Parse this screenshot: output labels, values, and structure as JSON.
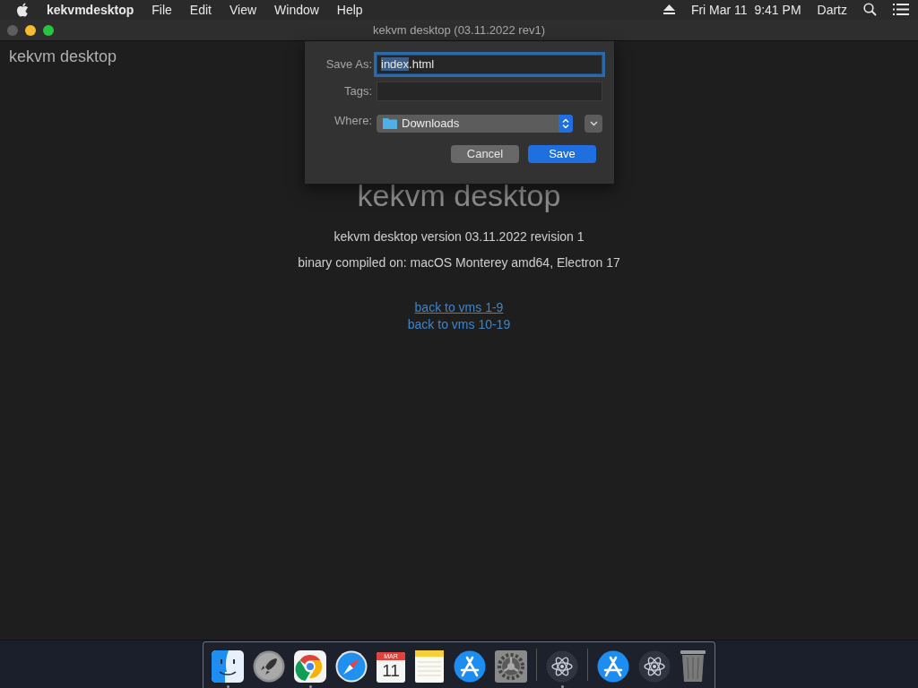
{
  "menu_bar": {
    "app_name": "kekvmdesktop",
    "menus": [
      "File",
      "Edit",
      "View",
      "Window",
      "Help"
    ],
    "clock": "Fri Mar 11  9:41 PM",
    "user": "Dartz"
  },
  "window": {
    "title": "kekvm desktop (03.11.2022 rev1)",
    "traffic_lights": [
      {
        "color": "#5e5e5e"
      },
      {
        "color": "#f4bd2f"
      },
      {
        "color": "#29c440"
      }
    ]
  },
  "page": {
    "corner_title": "kekvm desktop",
    "heading": "kekvm desktop",
    "version_line": "kekvm desktop version 03.11.2022 revision 1",
    "build_line": "binary compiled on: macOS Monterey amd64, Electron 17",
    "links": [
      {
        "label": "back to vms 1-9",
        "underlined": true
      },
      {
        "label": "back to vms 10-19",
        "underlined": false
      }
    ]
  },
  "save_sheet": {
    "save_as": {
      "label": "Save As:",
      "value_parts": [
        {
          "text": "index",
          "selected": true
        },
        {
          "text": ".html",
          "selected": false
        }
      ],
      "focused": true
    },
    "tags": {
      "label": "Tags:"
    },
    "where": {
      "label": "Where:",
      "value": "Downloads"
    },
    "buttons": [
      {
        "label": "Cancel",
        "default": false
      },
      {
        "label": "Save",
        "default": true
      }
    ]
  },
  "dock": [
    {
      "kind": "finder",
      "running": true
    },
    {
      "kind": "rocket",
      "running": false
    },
    {
      "kind": "chrome",
      "running": true
    },
    {
      "kind": "compass",
      "running": false
    },
    {
      "kind": "calendar",
      "running": false,
      "month": "MAR",
      "day": "11"
    },
    {
      "kind": "notes",
      "running": false
    },
    {
      "kind": "appstore",
      "running": false
    },
    {
      "kind": "gear",
      "running": false
    },
    {
      "kind": "separator"
    },
    {
      "kind": "atom",
      "running": true
    },
    {
      "kind": "separator"
    },
    {
      "kind": "appstore",
      "running": false
    },
    {
      "kind": "atom",
      "running": false
    },
    {
      "kind": "trash",
      "running": false
    }
  ]
}
